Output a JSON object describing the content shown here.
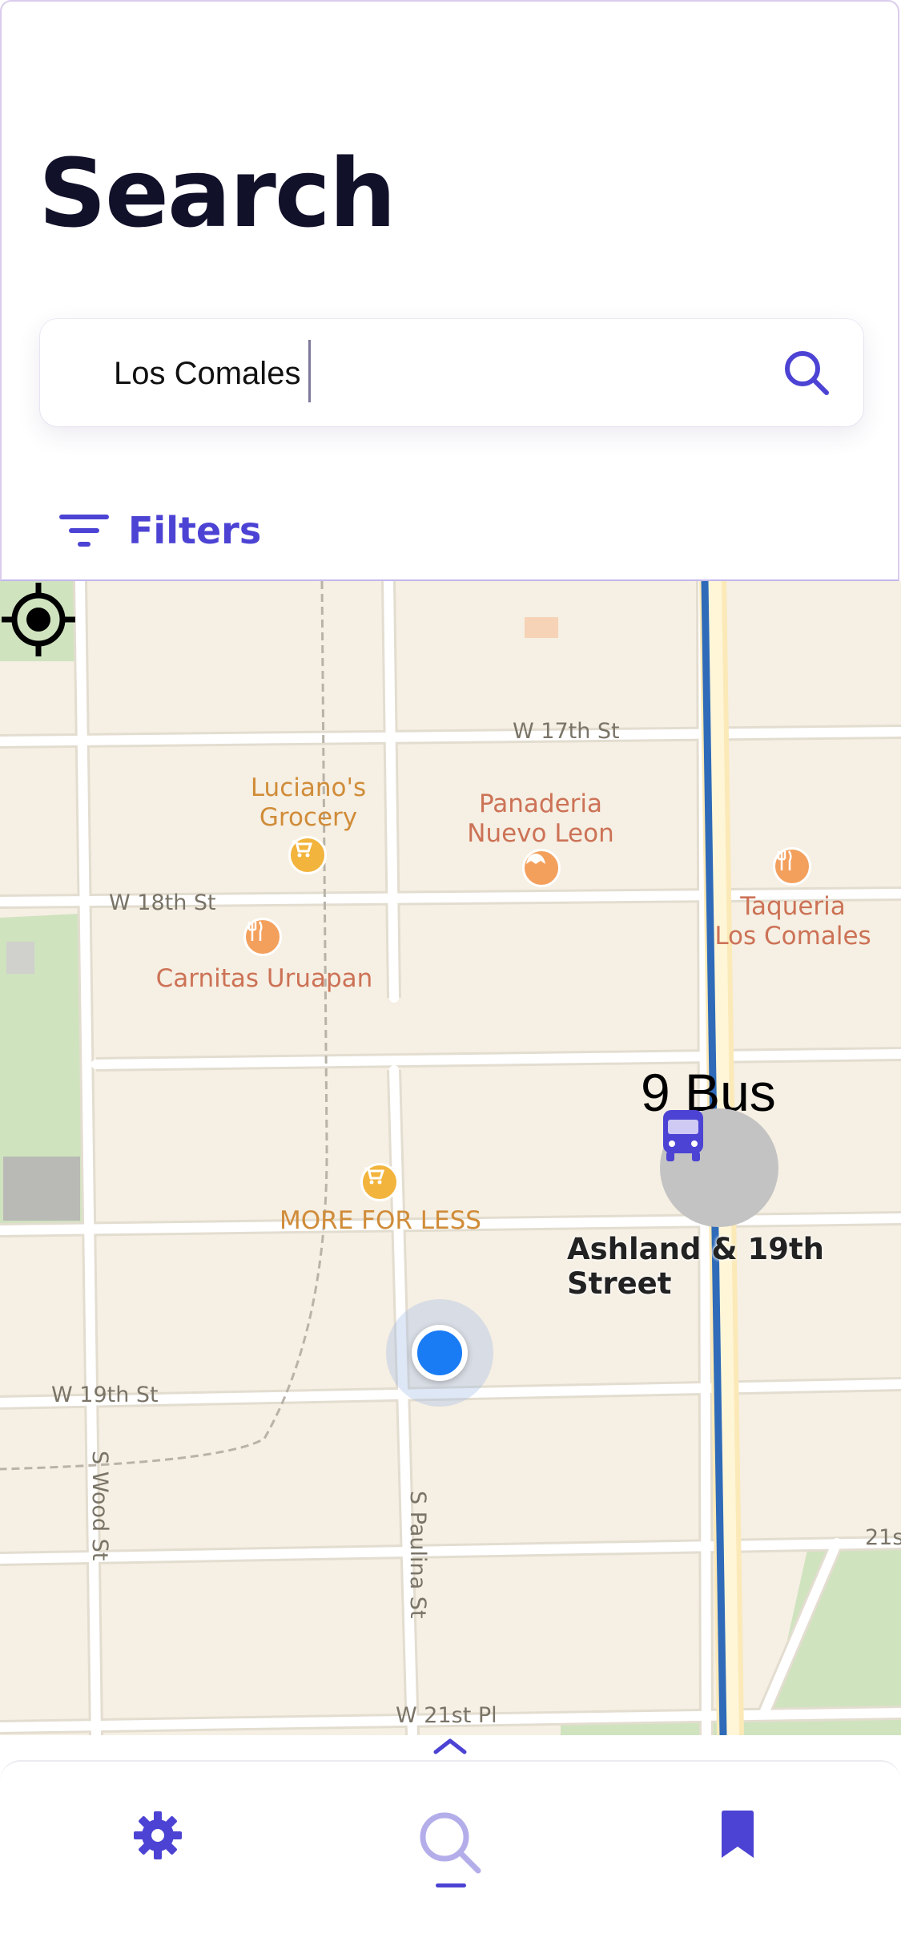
{
  "header": {
    "title": "Search",
    "search": {
      "value": "Los Comales",
      "placeholder": ""
    },
    "filters_label": "Filters"
  },
  "map": {
    "streets": [
      "W 17th St",
      "W 18th St",
      "W 19th St",
      "S Wood St",
      "S Paulina St",
      "W 21st Pl",
      "21s"
    ],
    "pois": [
      {
        "name": "Luciano's\nGrocery",
        "icon": "shopping-cart-icon"
      },
      {
        "name": "Panaderia\nNuevo Leon",
        "icon": "bakery-icon"
      },
      {
        "name": "Carnitas Uruapan",
        "icon": "restaurant-icon"
      },
      {
        "name": "Taqueria\nLos Comales",
        "icon": "restaurant-icon"
      },
      {
        "name": "MORE FOR LESS",
        "icon": "shopping-cart-icon"
      }
    ],
    "transit_stop": {
      "route": "9 Bus",
      "name": "Ashland & 19th Street",
      "icon": "bus-icon"
    }
  },
  "tabbar": {
    "tabs": [
      {
        "name": "settings",
        "icon": "gear-icon",
        "active": false
      },
      {
        "name": "search",
        "icon": "search-icon",
        "active": true
      },
      {
        "name": "saved",
        "icon": "bookmark-icon",
        "active": false
      }
    ]
  },
  "colors": {
    "accent": "#4c43d4",
    "title": "#12112a",
    "map_bg": "#f6efe3",
    "transit_line": "#2f6bb8",
    "user_location": "#1a7cf5"
  }
}
